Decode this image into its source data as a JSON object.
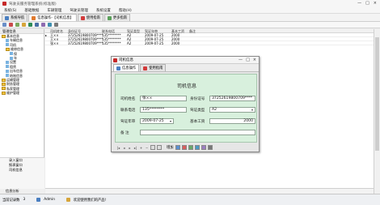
{
  "app": {
    "title": "驾驶员服务管理系统(标准版)",
    "window_controls": [
      "—",
      "□",
      "×"
    ]
  },
  "menu": [
    "系统(S)",
    "基础数据",
    "车辆管理",
    "驾驶员管理",
    "系统设置",
    "帮助(H)"
  ],
  "tabs": [
    {
      "label": "系统导航"
    },
    {
      "label": "信息操作-【司机信息】"
    },
    {
      "label": "使用指南"
    },
    {
      "label": "更多指南"
    }
  ],
  "left_pane": {
    "header": "管理信息",
    "tree": [
      {
        "label": "基本信息",
        "indent": 0,
        "type": "folder"
      },
      {
        "label": "车辆信息",
        "indent": 1,
        "type": "leaf"
      },
      {
        "label": "司机",
        "indent": 1,
        "type": "leaf"
      },
      {
        "label": "维修信息",
        "indent": 1,
        "type": "folder"
      },
      {
        "label": "保",
        "indent": 2,
        "type": "leaf"
      },
      {
        "label": "年",
        "indent": 2,
        "type": "leaf"
      },
      {
        "label": "设置",
        "indent": 1,
        "type": "leaf"
      },
      {
        "label": "租赁",
        "indent": 1,
        "type": "leaf"
      },
      {
        "label": "出车信息",
        "indent": 1,
        "type": "leaf"
      },
      {
        "label": "结账信息",
        "indent": 1,
        "type": "leaf"
      },
      {
        "label": "运输管理",
        "indent": 0,
        "type": "folder"
      },
      {
        "label": "财务管理",
        "indent": 0,
        "type": "folder"
      },
      {
        "label": "私家管理",
        "indent": 0,
        "type": "folder"
      },
      {
        "label": "维护管理",
        "indent": 0,
        "type": "folder"
      }
    ],
    "nav": [
      "录入窗口",
      "报表窗口",
      "司机信息"
    ],
    "footer": "信息分析"
  },
  "grid": {
    "columns": [
      "司机姓名",
      "身份证号",
      "联系电话",
      "驾证类型",
      "驾证年审",
      "基本工资",
      "备注"
    ],
    "rows": [
      {
        "mark": "▸",
        "name": "王××",
        "id": "37252619800709****",
        "phone": "135********",
        "type": "A2",
        "date": "2009-07-25",
        "wage": "2000",
        "note": ""
      },
      {
        "mark": "",
        "name": "王××",
        "id": "37252619800709****",
        "phone": "135********",
        "type": "A2",
        "date": "2009-07-25",
        "wage": "2000",
        "note": ""
      },
      {
        "mark": "",
        "name": "张××",
        "id": "37252619800709****",
        "phone": "135********",
        "type": "A2",
        "date": "2009-07-25",
        "wage": "2000",
        "note": ""
      }
    ]
  },
  "dialog": {
    "title": "司机信息",
    "tabs": [
      {
        "label": "信息操作"
      },
      {
        "label": "使用指南"
      }
    ],
    "heading": "司机信息",
    "fields": {
      "name_label": "司机姓名",
      "name_value": "张××",
      "id_label": "身份证号",
      "id_value": "37252619800709****",
      "phone_label": "联系电话",
      "phone_value": "135********",
      "type_label": "驾证类型",
      "type_value": "A2",
      "date_label": "驾证年审",
      "date_value": "2009-07-25",
      "wage_label": "基本工资",
      "wage_value": "2000",
      "note_label": "备    注",
      "note_value": ""
    },
    "nav_label": "增加"
  },
  "status": {
    "user_label": "当前记录数",
    "user_value": "3",
    "operator": "Admin",
    "message": "欢迎使用我们的产品!"
  },
  "colors": {
    "form_bg": "#d8f0dd",
    "accent": "#c62828"
  }
}
